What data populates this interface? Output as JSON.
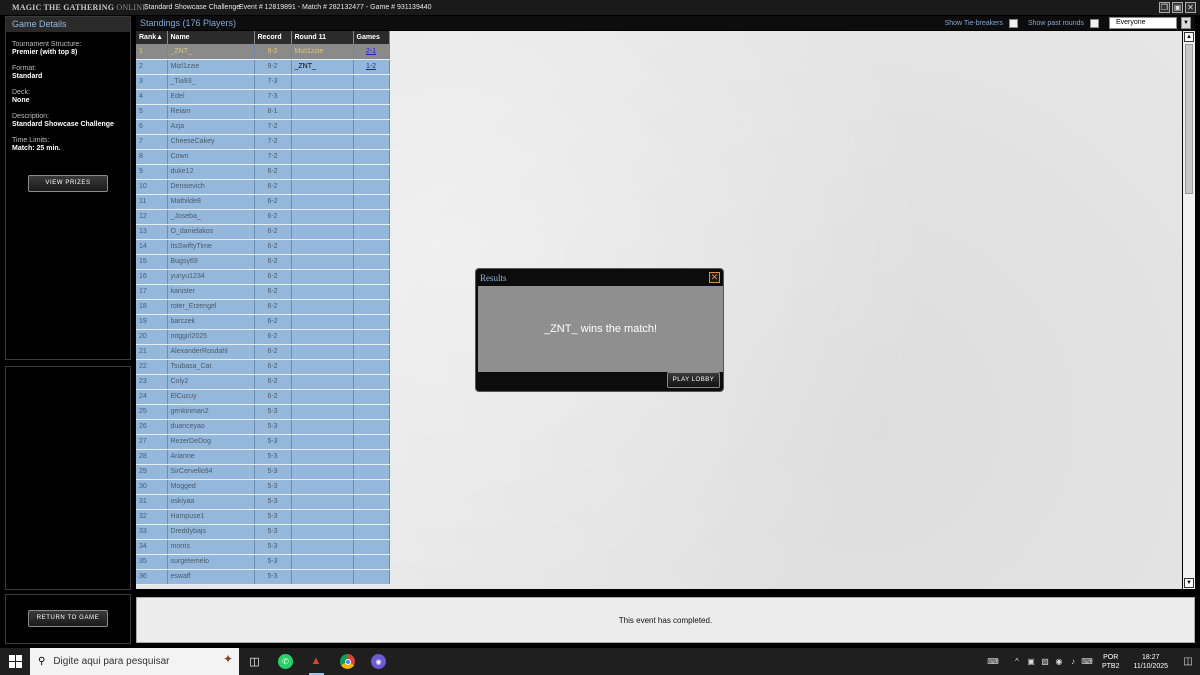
{
  "app": {
    "logo_main": "MAGIC THE GATHERING",
    "logo_sub": "ONLINE",
    "event_title": "Standard Showcase Challenge",
    "event_info": "Event # 12819891 - Match # 282132477 - Game # 931139440",
    "win_buttons": [
      "❒",
      "▣",
      "✕"
    ]
  },
  "game_details": {
    "header": "Game Details",
    "fields": [
      {
        "label": "Tournament Structure:",
        "value": "Premier (with top 8)"
      },
      {
        "label": "Format:",
        "value": "Standard"
      },
      {
        "label": "Deck:",
        "value": "None"
      },
      {
        "label": "Description:",
        "value": "Standard Showcase Challenge"
      },
      {
        "label": "Time Limits:",
        "value": "Match: 25 min."
      }
    ],
    "view_prizes": "VIEW PRIZES",
    "return_to_game": "RETURN TO GAME"
  },
  "standings": {
    "title": "Standings (176 Players)",
    "show_tiebreakers": "Show Tie-breakers",
    "show_past_rounds": "Show past rounds",
    "filter_value": "Everyone",
    "columns": [
      "Rank▲",
      "Name",
      "Record",
      "Round 11",
      "Games"
    ],
    "rows": [
      {
        "rank": "1",
        "name": "_ZNT_",
        "record": "9-2",
        "round": "Mizl1zzie",
        "games": "2-1"
      },
      {
        "rank": "2",
        "name": "Mizl1zzie",
        "record": "9-2",
        "round": "_ZNT_",
        "games": "1-2"
      },
      {
        "rank": "3",
        "name": "_Tia93_",
        "record": "7-3",
        "round": "",
        "games": ""
      },
      {
        "rank": "4",
        "name": "Edel",
        "record": "7-3",
        "round": "",
        "games": ""
      },
      {
        "rank": "5",
        "name": "Reiam",
        "record": "8-1",
        "round": "",
        "games": ""
      },
      {
        "rank": "6",
        "name": "Azja",
        "record": "7-2",
        "round": "",
        "games": ""
      },
      {
        "rank": "7",
        "name": "CheeseCakey",
        "record": "7-2",
        "round": "",
        "games": ""
      },
      {
        "rank": "8",
        "name": "Cown",
        "record": "7-2",
        "round": "",
        "games": ""
      },
      {
        "rank": "9",
        "name": "duke12",
        "record": "6-2",
        "round": "",
        "games": ""
      },
      {
        "rank": "10",
        "name": "Denisevich",
        "record": "6-2",
        "round": "",
        "games": ""
      },
      {
        "rank": "11",
        "name": "Mathilde8",
        "record": "6-2",
        "round": "",
        "games": ""
      },
      {
        "rank": "12",
        "name": "_Joseba_",
        "record": "6-2",
        "round": "",
        "games": ""
      },
      {
        "rank": "13",
        "name": "O_danielakos",
        "record": "6-2",
        "round": "",
        "games": ""
      },
      {
        "rank": "14",
        "name": "ItsSwiftyTime",
        "record": "6-2",
        "round": "",
        "games": ""
      },
      {
        "rank": "15",
        "name": "Bugsy69",
        "record": "6-2",
        "round": "",
        "games": ""
      },
      {
        "rank": "16",
        "name": "yunyu1234",
        "record": "6-2",
        "round": "",
        "games": ""
      },
      {
        "rank": "17",
        "name": "kanister",
        "record": "6-2",
        "round": "",
        "games": ""
      },
      {
        "rank": "18",
        "name": "roter_Erzengel",
        "record": "6-2",
        "round": "",
        "games": ""
      },
      {
        "rank": "19",
        "name": "barczek",
        "record": "6-2",
        "round": "",
        "games": ""
      },
      {
        "rank": "20",
        "name": "mtggirl2025",
        "record": "6-2",
        "round": "",
        "games": ""
      },
      {
        "rank": "21",
        "name": "AlexanderRosdahl",
        "record": "6-2",
        "round": "",
        "games": ""
      },
      {
        "rank": "22",
        "name": "Tsubasa_Cat",
        "record": "6-2",
        "round": "",
        "games": ""
      },
      {
        "rank": "23",
        "name": "Coly2",
        "record": "6-2",
        "round": "",
        "games": ""
      },
      {
        "rank": "24",
        "name": "ElCucuy",
        "record": "6-2",
        "round": "",
        "games": ""
      },
      {
        "rank": "25",
        "name": "genkinman2",
        "record": "5-3",
        "round": "",
        "games": ""
      },
      {
        "rank": "26",
        "name": "duanceyao",
        "record": "5-3",
        "round": "",
        "games": ""
      },
      {
        "rank": "27",
        "name": "RezerDeDog",
        "record": "5-3",
        "round": "",
        "games": ""
      },
      {
        "rank": "28",
        "name": "Arianne",
        "record": "5-3",
        "round": "",
        "games": ""
      },
      {
        "rank": "29",
        "name": "SirCervello94",
        "record": "5-3",
        "round": "",
        "games": ""
      },
      {
        "rank": "30",
        "name": "Mogged",
        "record": "5-3",
        "round": "",
        "games": ""
      },
      {
        "rank": "31",
        "name": "oskiyaa",
        "record": "5-3",
        "round": "",
        "games": ""
      },
      {
        "rank": "32",
        "name": "Hampuse1",
        "record": "5-3",
        "round": "",
        "games": ""
      },
      {
        "rank": "33",
        "name": "Dreddybajs",
        "record": "5-3",
        "round": "",
        "games": ""
      },
      {
        "rank": "34",
        "name": "morris",
        "record": "5-3",
        "round": "",
        "games": ""
      },
      {
        "rank": "35",
        "name": "surgetemelo",
        "record": "5-3",
        "round": "",
        "games": ""
      },
      {
        "rank": "36",
        "name": "eswaff",
        "record": "5-3",
        "round": "",
        "games": ""
      }
    ]
  },
  "results_dialog": {
    "title": "Results",
    "message": "_ZNT_ wins the match!",
    "button": "PLAY LOBBY"
  },
  "status_message": "This event has completed.",
  "taskbar": {
    "search_placeholder": "Digite aqui para pesquisar",
    "lang_line1": "POR",
    "lang_line2": "PTB2",
    "time": "18:27",
    "date": "11/10/2025"
  },
  "colors": {
    "accent": "#7fa9d8",
    "row_bg": "#94b8dc",
    "selected_row": "#8a8a8a",
    "link": "#1d1dd8"
  }
}
